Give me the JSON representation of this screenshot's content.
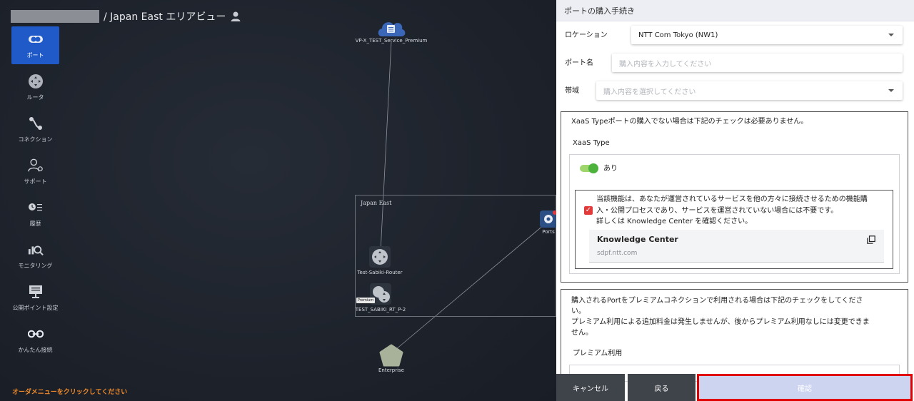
{
  "header": {
    "title": "/ Japan East エリアビュー"
  },
  "sidebar": {
    "items": [
      {
        "label": "ポート",
        "icon": "port-icon",
        "active": true
      },
      {
        "label": "ルータ",
        "icon": "router-icon",
        "active": false
      },
      {
        "label": "コネクション",
        "icon": "connection-icon",
        "active": false
      },
      {
        "label": "サポート",
        "icon": "support-icon",
        "active": false
      },
      {
        "label": "履歴",
        "icon": "history-icon",
        "active": false
      },
      {
        "label": "モニタリング",
        "icon": "monitoring-icon",
        "active": false
      },
      {
        "label": "公開ポイント設定",
        "icon": "public-point-icon",
        "active": false
      },
      {
        "label": "かんたん接続",
        "icon": "easy-connect-icon",
        "active": false
      }
    ],
    "order_hint": "オーダメニューをクリックしてください"
  },
  "topology": {
    "cloud_node": "VP-X_TEST_Service_Premium",
    "area_label": "Japan East",
    "router1": "Test-Sabiki-Router",
    "router2": "TEST_SABIKI_RT_P-2",
    "premium_tag": "Premium",
    "ports_node": "Ports",
    "enterprise_node": "Enterprise"
  },
  "panel": {
    "title": "ポートの購入手続き",
    "location_label": "ロケーション",
    "location_value": "NTT Com Tokyo (NW1)",
    "port_name_label": "ポート名",
    "port_name_placeholder": "購入内容を入力してください",
    "bandwidth_label": "帯域",
    "bandwidth_placeholder": "購入内容を選択してください",
    "xaas_note": "XaaS Typeポートの購入でない場合は下記のチェックは必要ありません。",
    "xaas_title": "XaaS Type",
    "xaas_toggle_label": "あり",
    "xaas_desc_1": "当該機能は、あなたが運営されているサービスを他の方々に接続させるための機能購",
    "xaas_desc_2": "入・公開プロセスであり、サービスを運営されていない場合には不要です。",
    "xaas_desc_3": "詳しくは Knowledge Center を確認ください。",
    "kc_title": "Knowledge Center",
    "kc_url": "sdpf.ntt.com",
    "premium_note_1": "購入されるPortをプレミアムコネクションで利用される場合は下記のチェックをしてくださ",
    "premium_note_2": "い。",
    "premium_note_3": "プレミアム利用による追加料金は発生しませんが、後からプレミアム利用なしには変更できま",
    "premium_note_4": "せん。",
    "premium_title": "プレミアム利用"
  },
  "footer": {
    "cancel": "キャンセル",
    "back": "戻る",
    "confirm": "確認"
  },
  "colors": {
    "accent": "#1f5ac8",
    "highlight": "#e00000",
    "toggle": "#4cb23c"
  }
}
